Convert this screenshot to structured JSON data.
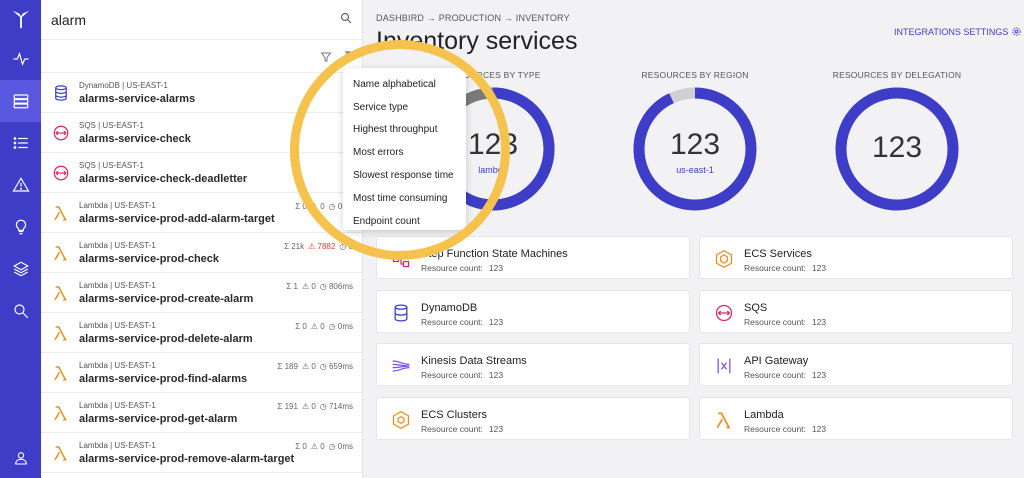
{
  "search": {
    "value": "alarm"
  },
  "results": [
    {
      "meta": "DynamoDB | US-EAST-1",
      "name": "alarms-service-alarms",
      "type": "dynamodb",
      "stats": []
    },
    {
      "meta": "SQS | US-EAST-1",
      "name": "alarms-service-check",
      "type": "sqs",
      "stats": []
    },
    {
      "meta": "SQS | US-EAST-1",
      "name": "alarms-service-check-deadletter",
      "type": "sqs",
      "stats": []
    },
    {
      "meta": "Lambda | US-EAST-1",
      "name": "alarms-service-prod-add-alarm-target",
      "type": "lambda",
      "stats": [
        "Σ 0",
        "⚠ 0",
        "◷ 0ms"
      ]
    },
    {
      "meta": "Lambda | US-EAST-1",
      "name": "alarms-service-prod-check",
      "type": "lambda",
      "stats": [
        "Σ 21k",
        "⚠ 7882",
        "◷ 0"
      ]
    },
    {
      "meta": "Lambda | US-EAST-1",
      "name": "alarms-service-prod-create-alarm",
      "type": "lambda",
      "stats": [
        "Σ 1",
        "⚠ 0",
        "◷ 806ms"
      ]
    },
    {
      "meta": "Lambda | US-EAST-1",
      "name": "alarms-service-prod-delete-alarm",
      "type": "lambda",
      "stats": [
        "Σ 0",
        "⚠ 0",
        "◷ 0ms"
      ]
    },
    {
      "meta": "Lambda | US-EAST-1",
      "name": "alarms-service-prod-find-alarms",
      "type": "lambda",
      "stats": [
        "Σ 189",
        "⚠ 0",
        "◷ 659ms"
      ]
    },
    {
      "meta": "Lambda | US-EAST-1",
      "name": "alarms-service-prod-get-alarm",
      "type": "lambda",
      "stats": [
        "Σ 191",
        "⚠ 0",
        "◷ 714ms"
      ]
    },
    {
      "meta": "Lambda | US-EAST-1",
      "name": "alarms-service-prod-remove-alarm-target",
      "type": "lambda",
      "stats": [
        "Σ 0",
        "⚠ 0",
        "◷ 0ms"
      ]
    }
  ],
  "sort_menu": [
    "Name alphabetical",
    "Service type",
    "Highest throughput",
    "Most errors",
    "Slowest response time",
    "Most time consuming",
    "Endpoint count"
  ],
  "breadcrumb": "DASHBIRD → PRODUCTION → INVENTORY",
  "page_title": "Inventory services",
  "integrations_label": "INTEGRATIONS SETTINGS",
  "donuts": [
    {
      "label": "RESOURCES BY TYPE",
      "value": "123",
      "sub": "lambda",
      "fill": 0.62
    },
    {
      "label": "RESOURCES BY REGION",
      "value": "123",
      "sub": "us-east-1",
      "fill": 0.93
    },
    {
      "label": "RESOURCES BY DELEGATION",
      "value": "123",
      "sub": "",
      "fill": 1.0
    }
  ],
  "count_label": "Resource count:",
  "services": [
    {
      "name": "Step Function State Machines",
      "count": "123",
      "icon": "step-function"
    },
    {
      "name": "ECS Services",
      "count": "123",
      "icon": "ecs"
    },
    {
      "name": "DynamoDB",
      "count": "123",
      "icon": "dynamodb"
    },
    {
      "name": "SQS",
      "count": "123",
      "icon": "sqs"
    },
    {
      "name": "Kinesis Data Streams",
      "count": "123",
      "icon": "kinesis"
    },
    {
      "name": "API Gateway",
      "count": "123",
      "icon": "api-gateway"
    },
    {
      "name": "ECS Clusters",
      "count": "123",
      "icon": "ecs-clusters"
    },
    {
      "name": "Lambda",
      "count": "123",
      "icon": "lambda"
    }
  ],
  "colors": {
    "accent": "#3d3dc8",
    "orange": "#f08c1e",
    "sqs": "#e0245e",
    "highlight": "#f5c34d"
  }
}
